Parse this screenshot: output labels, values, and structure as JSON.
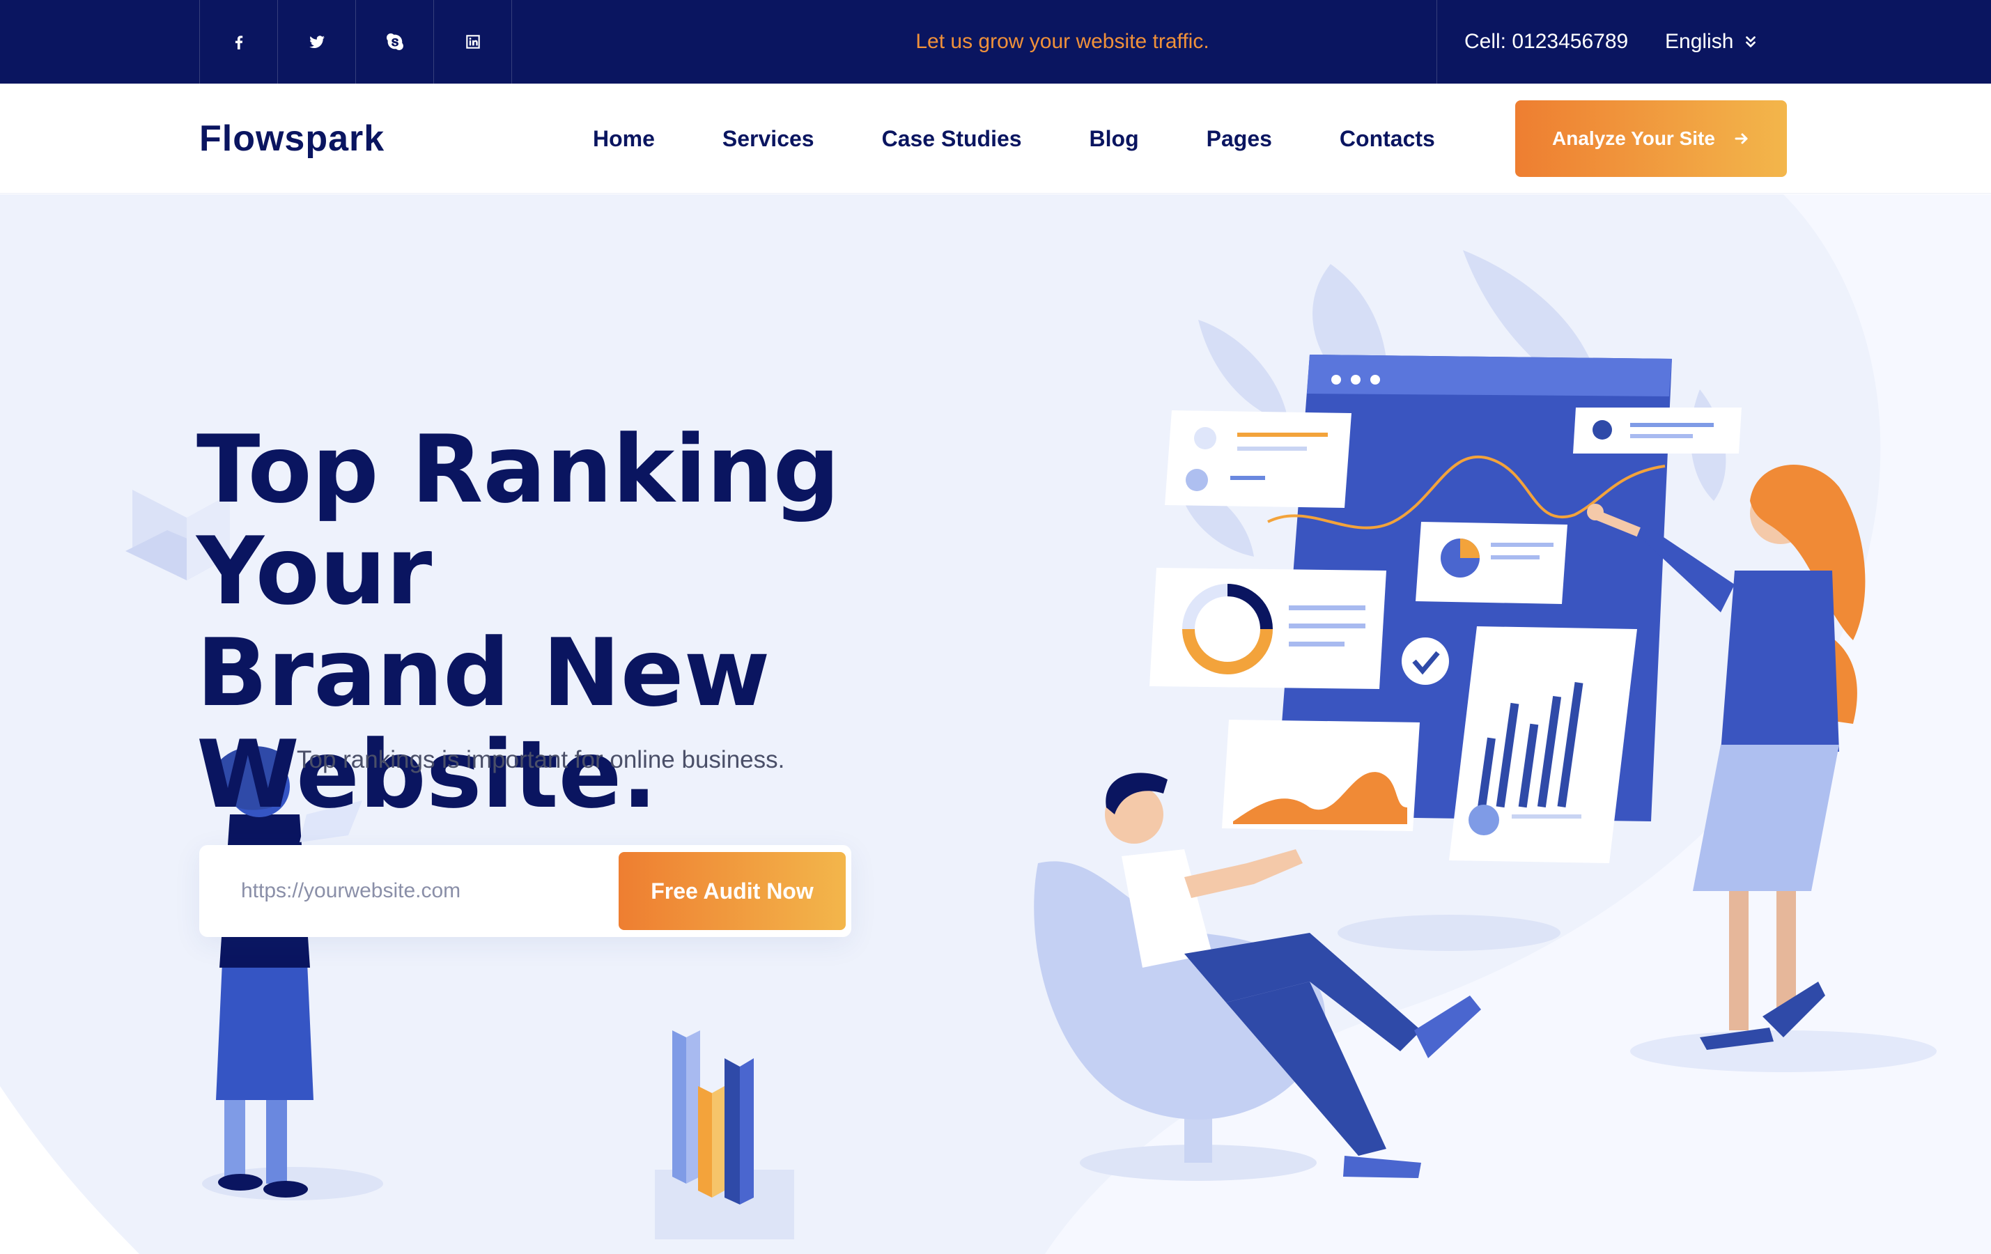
{
  "topbar": {
    "social": [
      {
        "icon": "facebook-icon"
      },
      {
        "icon": "twitter-icon"
      },
      {
        "icon": "skype-icon"
      },
      {
        "icon": "linkedin-icon"
      }
    ],
    "tagline": "Let us grow your website traffic.",
    "phone": "Cell: 0123456789",
    "language": "English"
  },
  "header": {
    "logo": "Flowspark",
    "nav": [
      "Home",
      "Services",
      "Case Studies",
      "Blog",
      "Pages",
      "Contacts"
    ],
    "cta_label": "Analyze Your Site"
  },
  "hero": {
    "title_lines": [
      "Top Ranking Your",
      "Brand New",
      "Website."
    ],
    "subtitle": "Top rankings is important for online business.",
    "url_placeholder": "https://yourwebsite.com",
    "audit_button": "Free Audit Now"
  },
  "colors": {
    "navy": "#0a1560",
    "accent_orange": "#ee7e31",
    "accent_yellow": "#f3b64b",
    "hero_bg": "#eef2fc",
    "illustration_blue": "#2f4aa8"
  }
}
